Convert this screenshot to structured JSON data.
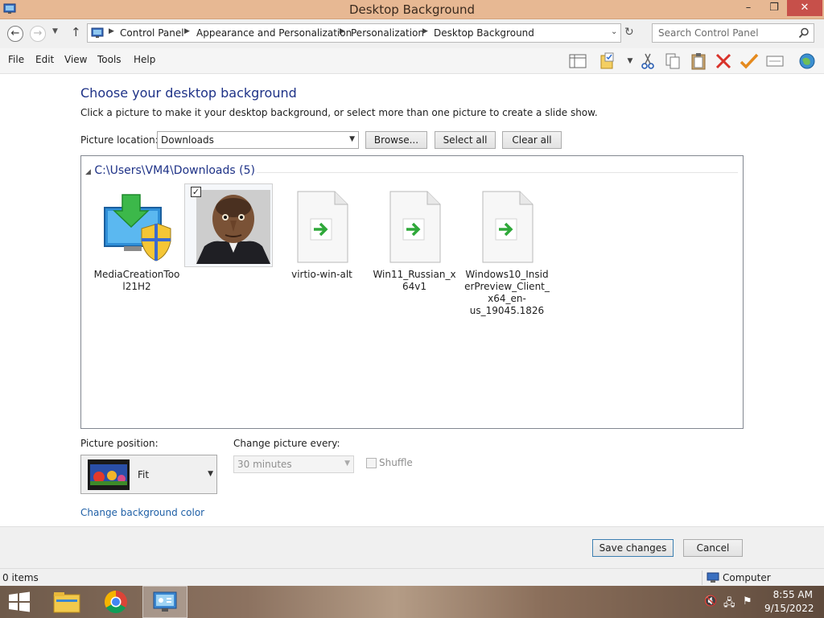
{
  "window": {
    "title": "Desktop Background",
    "min_glyph": "–",
    "max_glyph": "❐",
    "close_glyph": "✕"
  },
  "nav": {
    "back_glyph": "←",
    "forward_glyph": "→",
    "up_glyph": "↑",
    "breadcrumbs": [
      "Control Panel",
      "Appearance and Personalization",
      "Personalization",
      "Desktop Background"
    ],
    "search_placeholder": "Search Control Panel"
  },
  "menu": {
    "items": [
      "File",
      "Edit",
      "View",
      "Tools",
      "Help"
    ]
  },
  "content": {
    "heading": "Choose your desktop background",
    "subtext": "Click a picture to make it your desktop background, or select more than one picture to create a slide show.",
    "location_label": "Picture location:",
    "location_value": "Downloads",
    "browse_label": "Browse...",
    "select_all_label": "Select all",
    "clear_all_label": "Clear all",
    "group_header": "C:\\Users\\VM4\\Downloads (5)",
    "items": [
      {
        "name": "MediaCreationTool21H2",
        "type": "app-icon"
      },
      {
        "name": "",
        "type": "photo",
        "checked": true
      },
      {
        "name": "virtio-win-alt",
        "type": "shortcut"
      },
      {
        "name": "Win11_Russian_x64v1",
        "type": "shortcut"
      },
      {
        "name": "Windows10_InsiderPreview_Client_x64_en-us_19045.1826",
        "type": "shortcut"
      }
    ],
    "position_label": "Picture position:",
    "position_value": "Fit",
    "interval_label": "Change picture every:",
    "interval_value": "30 minutes",
    "shuffle_label": "Shuffle",
    "change_color_link": "Change background color",
    "save_label": "Save changes",
    "cancel_label": "Cancel"
  },
  "status": {
    "items_count": "0 items",
    "location": "Computer"
  },
  "taskbar": {
    "time": "8:55 AM",
    "date": "9/15/2022"
  },
  "colors": {
    "titlebar": "#e7b893",
    "heading": "#1e3287",
    "link": "#1e5fa6",
    "close": "#c7504a"
  }
}
